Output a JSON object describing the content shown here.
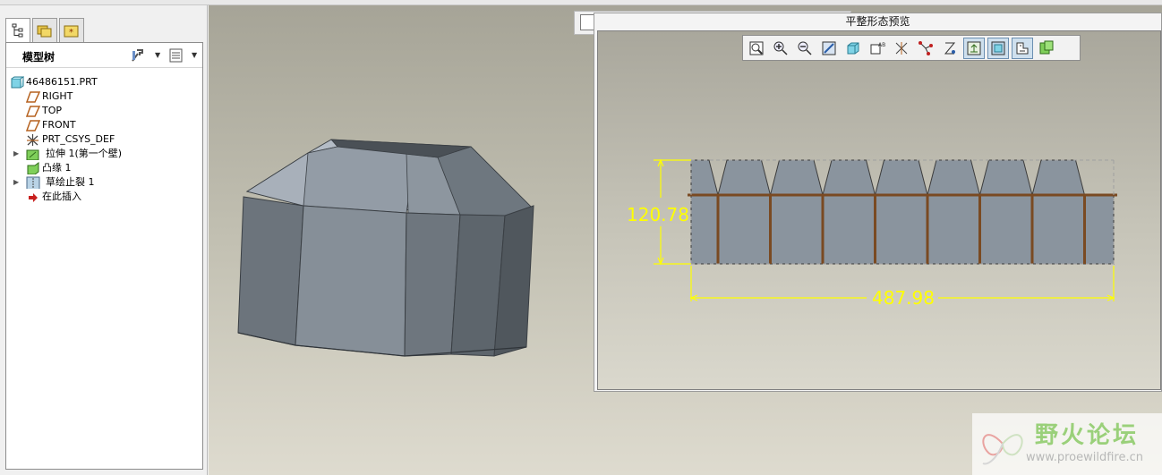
{
  "model_tree": {
    "title": "模型树",
    "items": [
      {
        "label": "46486151.PRT",
        "icon": "part-icon"
      },
      {
        "label": "RIGHT",
        "icon": "datum-plane-icon"
      },
      {
        "label": "TOP",
        "icon": "datum-plane-icon"
      },
      {
        "label": "FRONT",
        "icon": "datum-plane-icon"
      },
      {
        "label": "PRT_CSYS_DEF",
        "icon": "coordinate-system-icon"
      },
      {
        "label": "拉伸 1(第一个壁)",
        "icon": "extrude-wall-icon"
      },
      {
        "label": "凸缘 1",
        "icon": "flange-icon"
      },
      {
        "label": "草绘止裂 1",
        "icon": "sketched-rip-icon"
      },
      {
        "label": "在此插入",
        "icon": "insert-here-arrow-icon"
      }
    ]
  },
  "flat_preview": {
    "title": "平整形态预览",
    "dimensions": {
      "height": "120.78",
      "width": "487.98"
    }
  },
  "colors": {
    "dimension": "#ffff00",
    "face": "#8a949e"
  }
}
